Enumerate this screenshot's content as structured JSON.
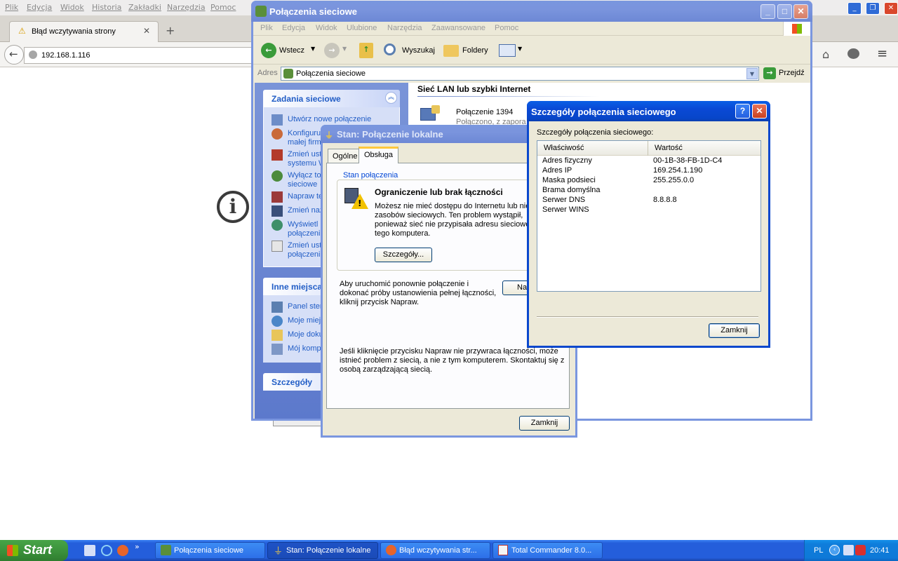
{
  "firefox": {
    "menu": [
      "Plik",
      "Edycja",
      "Widok",
      "Historia",
      "Zakładki",
      "Narzędzia",
      "Pomoc"
    ],
    "tab_title": "Błąd wczytywania strony",
    "url": "192.168.1.116"
  },
  "explorer": {
    "title": "Połączenia sieciowe",
    "menu": [
      "Plik",
      "Edycja",
      "Widok",
      "Ulubione",
      "Narzędzia",
      "Zaawansowane",
      "Pomoc"
    ],
    "toolbar": {
      "back": "Wstecz",
      "search": "Wyszukaj",
      "folders": "Foldery"
    },
    "address_label": "Adres",
    "address_value": "Połączenia sieciowe",
    "go_label": "Przejdź",
    "network_tasks_title": "Zadania sieciowe",
    "tasks": [
      {
        "label": "Utwórz nowe połączenie",
        "icon": "new-connection-icon"
      },
      {
        "label": "Konfiguru\nmałej firm",
        "icon": "home-network-icon"
      },
      {
        "label": "Zmień ust\nsystemu W",
        "icon": "firewall-icon"
      },
      {
        "label": "Wyłącz to\nsieciowe",
        "icon": "disable-device-icon"
      },
      {
        "label": "Napraw te",
        "icon": "repair-icon"
      },
      {
        "label": "Zmień naz",
        "icon": "rename-icon"
      },
      {
        "label": "Wyświetl\npołączeni",
        "icon": "view-status-icon"
      },
      {
        "label": "Zmień ust\npołączeni",
        "icon": "properties-icon"
      }
    ],
    "other_places_title": "Inne miejsca",
    "other_places": [
      {
        "label": "Panel ster",
        "icon": "control-panel-icon"
      },
      {
        "label": "Moje miej",
        "icon": "network-places-icon"
      },
      {
        "label": "Moje doku",
        "icon": "documents-icon"
      },
      {
        "label": "Mój komp",
        "icon": "computer-icon"
      }
    ],
    "details_title": "Szczegóły",
    "group_header": "Sieć LAN lub szybki Internet",
    "connection_name": "Połączenie 1394",
    "connection_status": "Połączono, z zapora"
  },
  "status_dialog": {
    "title": "Stan: Połączenie lokalne",
    "tabs": [
      "Ogólne",
      "Obsługa"
    ],
    "group_label": "Stan połączenia",
    "warning_title": "Ograniczenie lub brak łączności",
    "warning_text": "Możesz nie mieć dostępu do Internetu lub niek\nzasobów sieciowych. Ten problem wystąpił,\nponieważ sieć nie przypisała adresu sieciowe\ntego komputera.",
    "details_button": "Szczegóły...",
    "repair_text": "Aby uruchomić ponownie połączenie i\ndokonać próby ustanowienia pełnej łączności,\nkliknij przycisk Napraw.",
    "repair_button": "Na",
    "footer_text": "Jeśli kliknięcie przycisku Napraw nie przywraca łączności, może\nistnieć problem z siecią, a nie z tym komputerem. Skontaktuj się z\nosobą zarządzającą siecią.",
    "close_button": "Zamknij"
  },
  "details_dialog": {
    "title": "Szczegóły połączenia sieciowego",
    "caption": "Szczegóły połączenia sieciowego:",
    "columns": [
      "Właściwość",
      "Wartość"
    ],
    "rows": [
      {
        "property": "Adres fizyczny",
        "value": "00-1B-38-FB-1D-C4"
      },
      {
        "property": "Adres IP",
        "value": "169.254.1.190"
      },
      {
        "property": "Maska podsieci",
        "value": "255.255.0.0"
      },
      {
        "property": "Brama domyślna",
        "value": ""
      },
      {
        "property": "Serwer DNS",
        "value": "8.8.8.8"
      },
      {
        "property": "Serwer WINS",
        "value": ""
      }
    ],
    "close_button": "Zamknij"
  },
  "taskbar": {
    "start_label": "Start",
    "tasks": [
      {
        "label": "Połączenia sieciowe",
        "icon": "network-connections-icon",
        "active": false
      },
      {
        "label": "Stan: Połączenie lokalne",
        "icon": "lan-icon",
        "active": true
      },
      {
        "label": "Błąd wczytywania str...",
        "icon": "firefox-icon",
        "active": false
      },
      {
        "label": "Total Commander 8.0...",
        "icon": "total-commander-icon",
        "active": false
      }
    ],
    "language": "PL",
    "clock": "20:41"
  }
}
